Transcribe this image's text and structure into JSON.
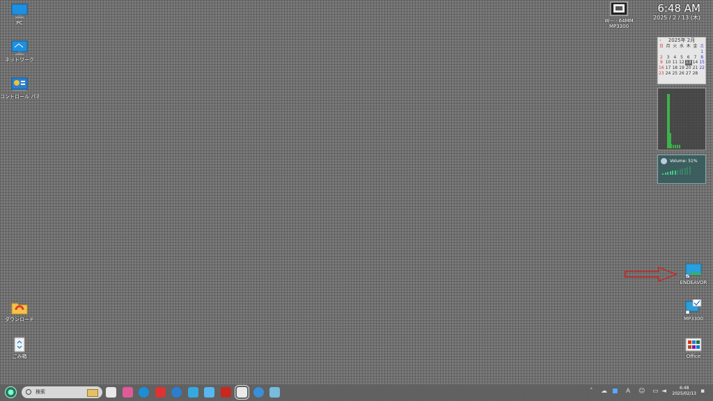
{
  "desktop_left": [
    {
      "label": "PC",
      "icon": "pc-monitor-icon"
    },
    {
      "label": "ネットワーク",
      "icon": "network-icon"
    },
    {
      "label": "コントロール パネル",
      "icon": "control-panel-icon"
    },
    {
      "label": "ダウンロード",
      "icon": "downloads-folder-icon"
    },
    {
      "label": "ごみ箱",
      "icon": "recycle-bin-icon"
    }
  ],
  "desktop_top_widget": {
    "line1": "W··· · 64MM",
    "line2": "MP3300"
  },
  "clock": {
    "time": "6:48 AM",
    "date": "2025 / 2 / 13 (木)"
  },
  "calendar": {
    "title": "2025年 2月",
    "weekdays": [
      "日",
      "月",
      "火",
      "水",
      "木",
      "金",
      "土"
    ],
    "rows": [
      [
        "",
        "",
        "",
        "",
        "",
        "",
        "1"
      ],
      [
        "2",
        "3",
        "4",
        "5",
        "6",
        "7",
        "8"
      ],
      [
        "9",
        "10",
        "11",
        "12",
        "13",
        "14",
        "15"
      ],
      [
        "16",
        "17",
        "18",
        "19",
        "20",
        "21",
        "22"
      ],
      [
        "23",
        "24",
        "25",
        "26",
        "27",
        "28",
        ""
      ]
    ],
    "today": "13"
  },
  "volume": {
    "label": "Volume: 51%",
    "percent": 51
  },
  "desktop_right": [
    {
      "label": "ENDEAVOR",
      "icon": "endeavor-shortcut-icon"
    },
    {
      "label": "MP3300",
      "icon": "mp3300-shortcut-icon"
    },
    {
      "label": "Office",
      "icon": "office-folder-icon"
    }
  ],
  "taskbar": {
    "search_placeholder": "検索",
    "pinned": [
      "task-view-icon",
      "paint-app-icon",
      "edge-icon",
      "red-app-icon",
      "blue-circle-app-icon",
      "settings-app-icon",
      "store-app-icon",
      "word-app-icon",
      "active-editor-icon",
      "media-app-icon",
      "color-app-icon"
    ],
    "tray_time": "6:48",
    "tray_date": "2025/02/13",
    "ime": "A"
  },
  "colors": {
    "accent_green": "#3cb34a",
    "arrow_red": "#d22020",
    "taskbar": "#5f5f5f"
  }
}
